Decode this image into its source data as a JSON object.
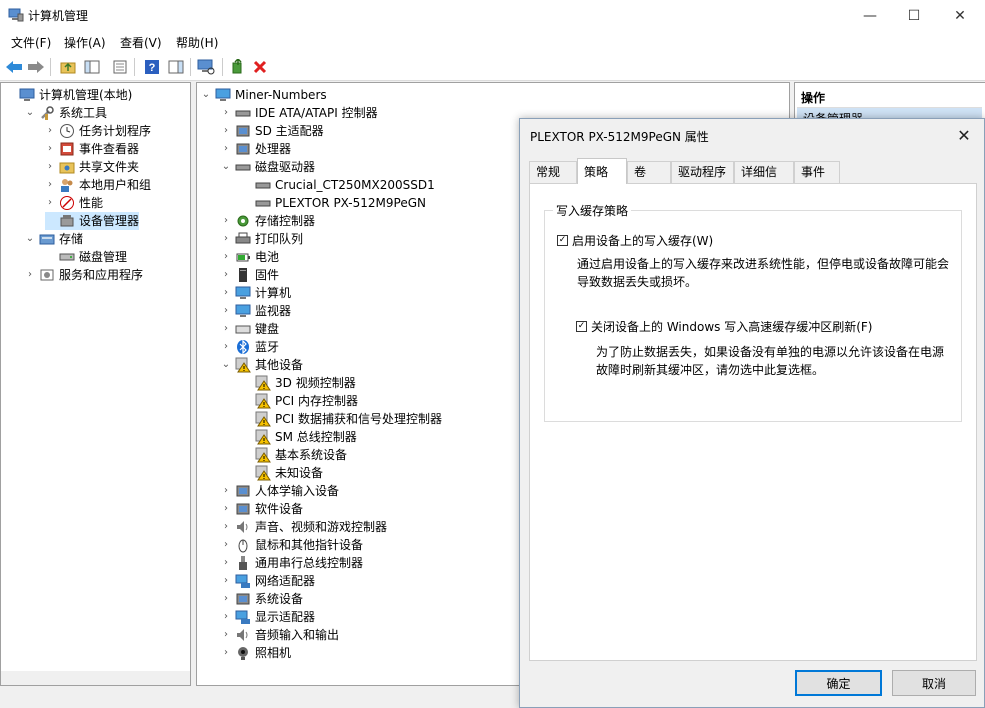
{
  "window": {
    "title": "计算机管理",
    "minimize": "—",
    "maximize": "☐",
    "close": "✕"
  },
  "menu": [
    "文件(F)",
    "操作(A)",
    "查看(V)",
    "帮助(H)"
  ],
  "left_tree": [
    {
      "label": "计算机管理(本地)",
      "level": 0,
      "chev": ""
    },
    {
      "label": "系统工具",
      "level": 1,
      "chev": "⌄"
    },
    {
      "label": "任务计划程序",
      "level": 2,
      "chev": "›"
    },
    {
      "label": "事件查看器",
      "level": 2,
      "chev": "›"
    },
    {
      "label": "共享文件夹",
      "level": 2,
      "chev": "›"
    },
    {
      "label": "本地用户和组",
      "level": 2,
      "chev": "›"
    },
    {
      "label": "性能",
      "level": 2,
      "chev": "›"
    },
    {
      "label": "设备管理器",
      "level": 2,
      "chev": ""
    },
    {
      "label": "存储",
      "level": 1,
      "chev": "⌄"
    },
    {
      "label": "磁盘管理",
      "level": 2,
      "chev": ""
    },
    {
      "label": "服务和应用程序",
      "level": 1,
      "chev": "›"
    }
  ],
  "device_tree": {
    "root": "Miner-Numbers",
    "items": [
      {
        "label": "IDE ATA/ATAPI 控制器",
        "chev": "›",
        "indent": 1
      },
      {
        "label": "SD 主适配器",
        "chev": "›",
        "indent": 1
      },
      {
        "label": "处理器",
        "chev": "›",
        "indent": 1
      },
      {
        "label": "磁盘驱动器",
        "chev": "⌄",
        "indent": 1
      },
      {
        "label": "Crucial_CT250MX200SSD1",
        "chev": "",
        "indent": 2
      },
      {
        "label": "PLEXTOR PX-512M9PeGN",
        "chev": "",
        "indent": 2
      },
      {
        "label": "存储控制器",
        "chev": "›",
        "indent": 1
      },
      {
        "label": "打印队列",
        "chev": "›",
        "indent": 1
      },
      {
        "label": "电池",
        "chev": "›",
        "indent": 1
      },
      {
        "label": "固件",
        "chev": "›",
        "indent": 1
      },
      {
        "label": "计算机",
        "chev": "›",
        "indent": 1
      },
      {
        "label": "监视器",
        "chev": "›",
        "indent": 1
      },
      {
        "label": "键盘",
        "chev": "›",
        "indent": 1
      },
      {
        "label": "蓝牙",
        "chev": "›",
        "indent": 1
      },
      {
        "label": "其他设备",
        "chev": "⌄",
        "indent": 1
      },
      {
        "label": "3D 视频控制器",
        "chev": "",
        "indent": 2
      },
      {
        "label": "PCI 内存控制器",
        "chev": "",
        "indent": 2
      },
      {
        "label": "PCI 数据捕获和信号处理控制器",
        "chev": "",
        "indent": 2
      },
      {
        "label": "SM 总线控制器",
        "chev": "",
        "indent": 2
      },
      {
        "label": "基本系统设备",
        "chev": "",
        "indent": 2
      },
      {
        "label": "未知设备",
        "chev": "",
        "indent": 2
      },
      {
        "label": "人体学输入设备",
        "chev": "›",
        "indent": 1
      },
      {
        "label": "软件设备",
        "chev": "›",
        "indent": 1
      },
      {
        "label": "声音、视频和游戏控制器",
        "chev": "›",
        "indent": 1
      },
      {
        "label": "鼠标和其他指针设备",
        "chev": "›",
        "indent": 1
      },
      {
        "label": "通用串行总线控制器",
        "chev": "›",
        "indent": 1
      },
      {
        "label": "网络适配器",
        "chev": "›",
        "indent": 1
      },
      {
        "label": "系统设备",
        "chev": "›",
        "indent": 1
      },
      {
        "label": "显示适配器",
        "chev": "›",
        "indent": 1
      },
      {
        "label": "音频输入和输出",
        "chev": "›",
        "indent": 1
      },
      {
        "label": "照相机",
        "chev": "›",
        "indent": 1
      }
    ]
  },
  "actions": {
    "header": "操作",
    "sub": "设备管理器"
  },
  "dialog": {
    "title": "PLEXTOR PX-512M9PeGN 属性",
    "tabs": [
      "常规",
      "策略",
      "卷",
      "驱动程序",
      "详细信息",
      "事件"
    ],
    "active_tab": "策略",
    "group_title": "写入缓存策略",
    "opt1_label": "启用设备上的写入缓存(W)",
    "opt1_desc1": "通过启用设备上的写入缓存来改进系统性能，但停电或设备故障可能会",
    "opt1_desc2": "导致数据丢失或损坏。",
    "opt2_label": "关闭设备上的 Windows 写入高速缓存缓冲区刷新(F)",
    "opt2_desc1": "为了防止数据丢失，如果设备没有单独的电源以允许该设备在电源",
    "opt2_desc2": "故障时刷新其缓冲区，请勿选中此复选框。",
    "ok": "确定",
    "cancel": "取消"
  }
}
